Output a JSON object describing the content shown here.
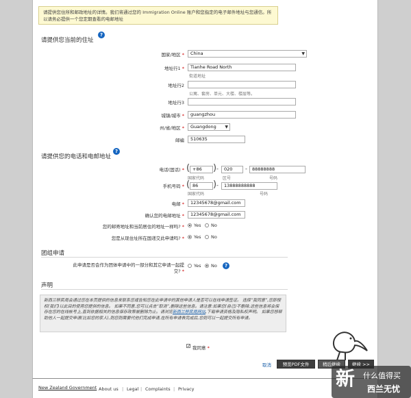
{
  "notice": "请提供您住所和邮政地址的详情。我们将通过您的 Immigration Online 账户和您指定的电子邮件地址与您通信。所以请务必提供一个您定期查看的电邮地址",
  "address_section": {
    "title": "请提供您当前的住址",
    "country_label": "国家/地区",
    "country_value": "China",
    "street1_label": "地址行1",
    "street1_value": "Tianhe Road North",
    "street1_hint": "街道地址",
    "street2_label": "地址行2",
    "street2_hint": "公寓、套房、单元、大楼、楼层等。",
    "street3_label": "地址行3",
    "city_label": "城镇/城市",
    "city_value": "guangzhou",
    "state_label": "州/省/地区",
    "state_value": "Guangdong",
    "postcode_label": "邮编",
    "postcode_value": "510635"
  },
  "contact_section": {
    "title": "请提供您的电话和电邮地址",
    "phone_label": "电话(固话)",
    "phone_country": "+86",
    "phone_area": "020",
    "phone_number": "88888888",
    "phone_country_hint": "国家代码",
    "phone_area_hint": "区号",
    "phone_number_hint": "号码",
    "mobile_label": "手机号码",
    "mobile_country": "86",
    "mobile_number": "13888888888",
    "mobile_country_hint": "国家代码",
    "mobile_number_hint": "号码",
    "email_label": "电邮",
    "email_value": "12345678@gmail.com",
    "email_confirm_label": "确认您的电邮地址",
    "email_confirm_value": "12345678@gmail.com",
    "same_address_q": "您的邮寄地址和当前居住的地址一样吗?",
    "same_address_yes": "Yes",
    "same_address_no": "No",
    "apply_from_country_q": "您是从现住址所在国递交此申请吗?",
    "apply_yes": "Yes",
    "apply_no": "No"
  },
  "group_section": {
    "title": "团组申请",
    "question": "此申请是否会作为团体申请中的一部分和其它申请一起提交?",
    "yes": "Yes",
    "no": "No"
  },
  "declaration": {
    "title": "声明",
    "text_before_link": "新西兰移民局会通过您在本页提供的信息来联系您或告知您在此申请中的其他申请人是否可以在线申请签证。 选择“我同意”,您即授权(我们)以此目的使用您提供的信息。 如果不同意,您可以点击“取消”,删除这些信息。请注意:如果您(自己)不删除,这些信息将会保存在您的在线帐号上,直到依据相关的信息保存政策被删除为止。请浏览",
    "link_text": "新西兰移民局网站",
    "text_after_link": ",下载申请资格及隐私权声明。 如果您想帮助他人一起提交申请(比如您的家人),则您则需要代他们完成申请,在所有申请表完成后,您则可以一起提交所有申请。",
    "agree_label": "我同意"
  },
  "actions": {
    "cancel": "取消",
    "preview": "预览PDF文件",
    "save_continue": "稍后继续",
    "continue": "继续 >>"
  },
  "footer": {
    "brand": "New Zealand Government",
    "links": [
      "About us",
      "Legal",
      "Complaints",
      "Privacy"
    ]
  },
  "watermark": {
    "char": "新",
    "top": "什么值得买",
    "bottom": "西兰无忧"
  }
}
